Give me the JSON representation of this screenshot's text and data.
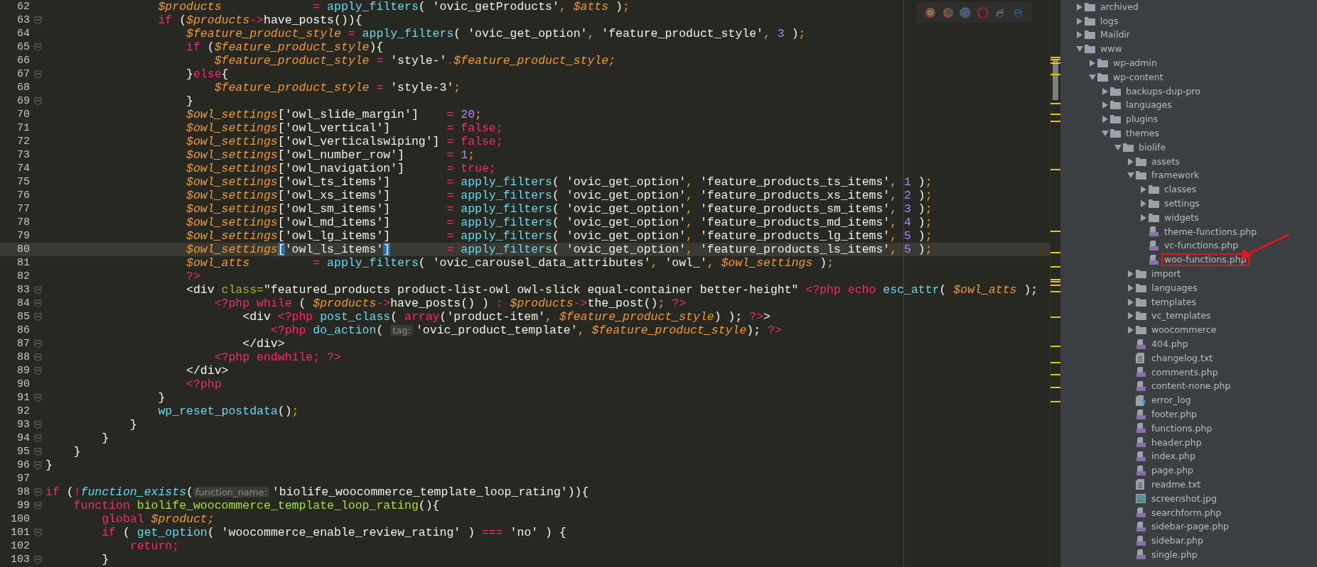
{
  "editor": {
    "lines": [
      {
        "number": "62",
        "fold": false,
        "current": false,
        "tokens": [
          {
            "kind": "var",
            "text": "                $products"
          },
          {
            "kind": "op",
            "text": "             ="
          },
          {
            "kind": "fn",
            "text": " apply_filters"
          },
          {
            "kind": "plain",
            "text": "( "
          },
          {
            "kind": "str",
            "text": "'ovic_getProducts'"
          },
          {
            "kind": "punc",
            "text": ", "
          },
          {
            "kind": "var",
            "text": "$atts"
          },
          {
            "kind": "plain",
            "text": " )"
          },
          {
            "kind": "punc",
            "text": ";"
          }
        ]
      },
      {
        "number": "63",
        "fold": true,
        "current": false,
        "tokens": [
          {
            "kind": "kw",
            "text": "                if"
          },
          {
            "kind": "plain",
            "text": " ("
          },
          {
            "kind": "var",
            "text": "$products"
          },
          {
            "kind": "op",
            "text": "->"
          },
          {
            "kind": "plain",
            "text": "have_posts()){"
          }
        ]
      },
      {
        "number": "64",
        "fold": false,
        "current": false,
        "tokens": [
          {
            "kind": "var",
            "text": "                    $feature_product_style"
          },
          {
            "kind": "op",
            "text": " ="
          },
          {
            "kind": "fn",
            "text": " apply_filters"
          },
          {
            "kind": "plain",
            "text": "( "
          },
          {
            "kind": "str",
            "text": "'ovic_get_option'"
          },
          {
            "kind": "punc",
            "text": ", "
          },
          {
            "kind": "str",
            "text": "'feature_product_style'"
          },
          {
            "kind": "punc",
            "text": ", "
          },
          {
            "kind": "num",
            "text": "3"
          },
          {
            "kind": "plain",
            "text": " )"
          },
          {
            "kind": "punc",
            "text": ";"
          }
        ]
      },
      {
        "number": "65",
        "fold": true,
        "current": false,
        "tokens": [
          {
            "kind": "kw",
            "text": "                    if"
          },
          {
            "kind": "plain",
            "text": " ("
          },
          {
            "kind": "var",
            "text": "$feature_product_style"
          },
          {
            "kind": "plain",
            "text": "){"
          }
        ]
      },
      {
        "number": "66",
        "fold": false,
        "current": false,
        "tokens": [
          {
            "kind": "var",
            "text": "                        $feature_product_style"
          },
          {
            "kind": "op",
            "text": " ="
          },
          {
            "kind": "str",
            "text": " 'style-'"
          },
          {
            "kind": "op",
            "text": "."
          },
          {
            "kind": "var",
            "text": "$feature_product_style;"
          }
        ]
      },
      {
        "number": "67",
        "fold": true,
        "current": false,
        "tokens": [
          {
            "kind": "plain",
            "text": "                    }"
          },
          {
            "kind": "kw",
            "text": "else"
          },
          {
            "kind": "plain",
            "text": "{"
          }
        ]
      },
      {
        "number": "68",
        "fold": false,
        "current": false,
        "tokens": [
          {
            "kind": "var",
            "text": "                        $feature_product_style"
          },
          {
            "kind": "op",
            "text": " ="
          },
          {
            "kind": "str",
            "text": " 'style-3'"
          },
          {
            "kind": "punc",
            "text": ";"
          }
        ]
      },
      {
        "number": "69",
        "fold": true,
        "current": false,
        "tokens": [
          {
            "kind": "plain",
            "text": "                    }"
          }
        ]
      },
      {
        "number": "70",
        "fold": false,
        "current": false,
        "tokens": [
          {
            "kind": "var",
            "text": "                    $owl_settings"
          },
          {
            "kind": "plain",
            "text": "["
          },
          {
            "kind": "str",
            "text": "'owl_slide_margin'"
          },
          {
            "kind": "plain",
            "text": "]    "
          },
          {
            "kind": "op",
            "text": "="
          },
          {
            "kind": "num",
            "text": " 20"
          },
          {
            "kind": "punc",
            "text": ";"
          }
        ]
      },
      {
        "number": "71",
        "fold": false,
        "current": false,
        "tokens": [
          {
            "kind": "var",
            "text": "                    $owl_settings"
          },
          {
            "kind": "plain",
            "text": "["
          },
          {
            "kind": "str",
            "text": "'owl_vertical'"
          },
          {
            "kind": "plain",
            "text": "]        "
          },
          {
            "kind": "op",
            "text": "="
          },
          {
            "kind": "kw",
            "text": " false;"
          }
        ]
      },
      {
        "number": "72",
        "fold": false,
        "current": false,
        "tokens": [
          {
            "kind": "var",
            "text": "                    $owl_settings"
          },
          {
            "kind": "plain",
            "text": "["
          },
          {
            "kind": "str",
            "text": "'owl_verticalswiping'"
          },
          {
            "kind": "plain",
            "text": "] "
          },
          {
            "kind": "op",
            "text": "="
          },
          {
            "kind": "kw",
            "text": " false;"
          }
        ]
      },
      {
        "number": "73",
        "fold": false,
        "current": false,
        "tokens": [
          {
            "kind": "var",
            "text": "                    $owl_settings"
          },
          {
            "kind": "plain",
            "text": "["
          },
          {
            "kind": "str",
            "text": "'owl_number_row'"
          },
          {
            "kind": "plain",
            "text": "]      "
          },
          {
            "kind": "op",
            "text": "="
          },
          {
            "kind": "num",
            "text": " 1"
          },
          {
            "kind": "punc",
            "text": ";"
          }
        ]
      },
      {
        "number": "74",
        "fold": false,
        "current": false,
        "tokens": [
          {
            "kind": "var",
            "text": "                    $owl_settings"
          },
          {
            "kind": "plain",
            "text": "["
          },
          {
            "kind": "str",
            "text": "'owl_navigation'"
          },
          {
            "kind": "plain",
            "text": "]      "
          },
          {
            "kind": "op",
            "text": "="
          },
          {
            "kind": "kw",
            "text": " true;"
          }
        ]
      },
      {
        "number": "75",
        "fold": false,
        "current": false,
        "tokens": [
          {
            "kind": "var",
            "text": "                    $owl_settings"
          },
          {
            "kind": "plain",
            "text": "["
          },
          {
            "kind": "str",
            "text": "'owl_ts_items'"
          },
          {
            "kind": "plain",
            "text": "]        "
          },
          {
            "kind": "op",
            "text": "="
          },
          {
            "kind": "fn",
            "text": " apply_filters"
          },
          {
            "kind": "plain",
            "text": "( "
          },
          {
            "kind": "str",
            "text": "'ovic_get_option'"
          },
          {
            "kind": "punc",
            "text": ", "
          },
          {
            "kind": "str",
            "text": "'feature_products_ts_items'"
          },
          {
            "kind": "punc",
            "text": ", "
          },
          {
            "kind": "num",
            "text": "1"
          },
          {
            "kind": "plain",
            "text": " )"
          },
          {
            "kind": "punc",
            "text": ";"
          }
        ]
      },
      {
        "number": "76",
        "fold": false,
        "current": false,
        "tokens": [
          {
            "kind": "var",
            "text": "                    $owl_settings"
          },
          {
            "kind": "plain",
            "text": "["
          },
          {
            "kind": "str",
            "text": "'owl_xs_items'"
          },
          {
            "kind": "plain",
            "text": "]        "
          },
          {
            "kind": "op",
            "text": "="
          },
          {
            "kind": "fn",
            "text": " apply_filters"
          },
          {
            "kind": "plain",
            "text": "( "
          },
          {
            "kind": "str",
            "text": "'ovic_get_option'"
          },
          {
            "kind": "punc",
            "text": ", "
          },
          {
            "kind": "str",
            "text": "'feature_products_xs_items'"
          },
          {
            "kind": "punc",
            "text": ", "
          },
          {
            "kind": "num",
            "text": "2"
          },
          {
            "kind": "plain",
            "text": " )"
          },
          {
            "kind": "punc",
            "text": ";"
          }
        ]
      },
      {
        "number": "77",
        "fold": false,
        "current": false,
        "tokens": [
          {
            "kind": "var",
            "text": "                    $owl_settings"
          },
          {
            "kind": "plain",
            "text": "["
          },
          {
            "kind": "str",
            "text": "'owl_sm_items'"
          },
          {
            "kind": "plain",
            "text": "]        "
          },
          {
            "kind": "op",
            "text": "="
          },
          {
            "kind": "fn",
            "text": " apply_filters"
          },
          {
            "kind": "plain",
            "text": "( "
          },
          {
            "kind": "str",
            "text": "'ovic_get_option'"
          },
          {
            "kind": "punc",
            "text": ", "
          },
          {
            "kind": "str",
            "text": "'feature_products_sm_items'"
          },
          {
            "kind": "punc",
            "text": ", "
          },
          {
            "kind": "num",
            "text": "3"
          },
          {
            "kind": "plain",
            "text": " )"
          },
          {
            "kind": "punc",
            "text": ";"
          }
        ]
      },
      {
        "number": "78",
        "fold": false,
        "current": false,
        "tokens": [
          {
            "kind": "var",
            "text": "                    $owl_settings"
          },
          {
            "kind": "plain",
            "text": "["
          },
          {
            "kind": "str",
            "text": "'owl_md_items'"
          },
          {
            "kind": "plain",
            "text": "]        "
          },
          {
            "kind": "op",
            "text": "="
          },
          {
            "kind": "fn",
            "text": " apply_filters"
          },
          {
            "kind": "plain",
            "text": "( "
          },
          {
            "kind": "str",
            "text": "'ovic_get_option'"
          },
          {
            "kind": "punc",
            "text": ", "
          },
          {
            "kind": "str",
            "text": "'feature_products_md_items'"
          },
          {
            "kind": "punc",
            "text": ", "
          },
          {
            "kind": "num",
            "text": "4"
          },
          {
            "kind": "plain",
            "text": " )"
          },
          {
            "kind": "punc",
            "text": ";"
          }
        ]
      },
      {
        "number": "79",
        "fold": false,
        "current": false,
        "tokens": [
          {
            "kind": "var",
            "text": "                    $owl_settings"
          },
          {
            "kind": "plain",
            "text": "["
          },
          {
            "kind": "str",
            "text": "'owl_lg_items'"
          },
          {
            "kind": "plain",
            "text": "]        "
          },
          {
            "kind": "op",
            "text": "="
          },
          {
            "kind": "fn",
            "text": " apply_filters"
          },
          {
            "kind": "plain",
            "text": "( "
          },
          {
            "kind": "str",
            "text": "'ovic_get_option'"
          },
          {
            "kind": "punc",
            "text": ", "
          },
          {
            "kind": "str",
            "text": "'feature_products_lg_items'"
          },
          {
            "kind": "punc",
            "text": ", "
          },
          {
            "kind": "num",
            "text": "5"
          },
          {
            "kind": "plain",
            "text": " )"
          },
          {
            "kind": "punc",
            "text": ";"
          }
        ]
      },
      {
        "number": "80",
        "fold": false,
        "current": true,
        "tokens": [
          {
            "kind": "var",
            "text": "                    $owl_settings"
          },
          {
            "kind": "match",
            "text": "["
          },
          {
            "kind": "str",
            "text": "'owl_ls_items'"
          },
          {
            "kind": "match",
            "text": "]"
          },
          {
            "kind": "op",
            "text": "        ="
          },
          {
            "kind": "fn",
            "text": " apply_filters"
          },
          {
            "kind": "plain",
            "text": "( "
          },
          {
            "kind": "str",
            "text": "'ovic_get_option'"
          },
          {
            "kind": "punc",
            "text": ", "
          },
          {
            "kind": "str",
            "text": "'feature_products_ls_items'"
          },
          {
            "kind": "punc",
            "text": ", "
          },
          {
            "kind": "num",
            "text": "5"
          },
          {
            "kind": "plain",
            "text": " )"
          },
          {
            "kind": "punc",
            "text": ";"
          }
        ]
      },
      {
        "number": "81",
        "fold": false,
        "current": false,
        "tokens": [
          {
            "kind": "var",
            "text": "                    $owl_atts"
          },
          {
            "kind": "op",
            "text": "         ="
          },
          {
            "kind": "fn",
            "text": " apply_filters"
          },
          {
            "kind": "plain",
            "text": "( "
          },
          {
            "kind": "str",
            "text": "'ovic_carousel_data_attributes'"
          },
          {
            "kind": "punc",
            "text": ", "
          },
          {
            "kind": "str",
            "text": "'owl_'"
          },
          {
            "kind": "punc",
            "text": ", "
          },
          {
            "kind": "var",
            "text": "$owl_settings"
          },
          {
            "kind": "plain",
            "text": " )"
          },
          {
            "kind": "punc",
            "text": ";"
          }
        ]
      },
      {
        "number": "82",
        "fold": false,
        "current": false,
        "tokens": [
          {
            "kind": "kw",
            "text": "                    ?>"
          }
        ]
      },
      {
        "number": "83",
        "fold": true,
        "current": false,
        "tokens": [
          {
            "kind": "plain",
            "text": "                    <div "
          },
          {
            "kind": "attr",
            "text": "class="
          },
          {
            "kind": "str",
            "text": "\"featured_products product-list-owl owl-slick equal-container better-height\""
          },
          {
            "kind": "kw",
            "text": " <?php echo"
          },
          {
            "kind": "fn",
            "text": " esc_attr"
          },
          {
            "kind": "plain",
            "text": "( "
          },
          {
            "kind": "var",
            "text": "$owl_atts"
          },
          {
            "kind": "plain",
            "text": " );"
          }
        ]
      },
      {
        "number": "84",
        "fold": true,
        "current": false,
        "tokens": [
          {
            "kind": "kw",
            "text": "                        <?php while"
          },
          {
            "kind": "plain",
            "text": " ( "
          },
          {
            "kind": "var",
            "text": "$products"
          },
          {
            "kind": "op",
            "text": "->"
          },
          {
            "kind": "plain",
            "text": "have_posts() ) "
          },
          {
            "kind": "op",
            "text": ":"
          },
          {
            "kind": "var",
            "text": " $products"
          },
          {
            "kind": "op",
            "text": "->"
          },
          {
            "kind": "plain",
            "text": "the_post()"
          },
          {
            "kind": "punc",
            "text": ";"
          },
          {
            "kind": "kw",
            "text": " ?>"
          }
        ]
      },
      {
        "number": "85",
        "fold": true,
        "current": false,
        "tokens": [
          {
            "kind": "plain",
            "text": "                            <div "
          },
          {
            "kind": "kw",
            "text": "<?php"
          },
          {
            "kind": "fn",
            "text": " post_class"
          },
          {
            "kind": "plain",
            "text": "( "
          },
          {
            "kind": "kw",
            "text": "array"
          },
          {
            "kind": "plain",
            "text": "("
          },
          {
            "kind": "str",
            "text": "'product-item'"
          },
          {
            "kind": "punc",
            "text": ", "
          },
          {
            "kind": "var",
            "text": "$feature_product_style"
          },
          {
            "kind": "plain",
            "text": ") ); "
          },
          {
            "kind": "kw",
            "text": "?>"
          },
          {
            "kind": "plain",
            "text": ">"
          }
        ]
      },
      {
        "number": "86",
        "fold": false,
        "current": false,
        "tokens": [
          {
            "kind": "kw",
            "text": "                                <?php"
          },
          {
            "kind": "fn",
            "text": " do_action"
          },
          {
            "kind": "plain",
            "text": "( "
          },
          {
            "kind": "hint",
            "text": "tag:"
          },
          {
            "kind": "str",
            "text": "'ovic_product_template'"
          },
          {
            "kind": "punc",
            "text": ", "
          },
          {
            "kind": "var",
            "text": "$feature_product_style"
          },
          {
            "kind": "plain",
            "text": "); "
          },
          {
            "kind": "kw",
            "text": "?>"
          }
        ]
      },
      {
        "number": "87",
        "fold": true,
        "current": false,
        "tokens": [
          {
            "kind": "plain",
            "text": "                            </div>"
          }
        ]
      },
      {
        "number": "88",
        "fold": true,
        "current": false,
        "tokens": [
          {
            "kind": "kw",
            "text": "                        <?php endwhile; ?>"
          }
        ]
      },
      {
        "number": "89",
        "fold": true,
        "current": false,
        "tokens": [
          {
            "kind": "plain",
            "text": "                    </div>"
          }
        ]
      },
      {
        "number": "90",
        "fold": false,
        "current": false,
        "tokens": [
          {
            "kind": "kw",
            "text": "                    <?php"
          }
        ]
      },
      {
        "number": "91",
        "fold": true,
        "current": false,
        "tokens": [
          {
            "kind": "plain",
            "text": "                }"
          }
        ]
      },
      {
        "number": "92",
        "fold": false,
        "current": false,
        "tokens": [
          {
            "kind": "fn",
            "text": "                wp_reset_postdata"
          },
          {
            "kind": "plain",
            "text": "()"
          },
          {
            "kind": "punc",
            "text": ";"
          }
        ]
      },
      {
        "number": "93",
        "fold": true,
        "current": false,
        "tokens": [
          {
            "kind": "plain",
            "text": "            }"
          }
        ]
      },
      {
        "number": "94",
        "fold": true,
        "current": false,
        "tokens": [
          {
            "kind": "plain",
            "text": "        }"
          }
        ]
      },
      {
        "number": "95",
        "fold": true,
        "current": false,
        "tokens": [
          {
            "kind": "plain",
            "text": "    }"
          }
        ]
      },
      {
        "number": "96",
        "fold": true,
        "current": false,
        "tokens": [
          {
            "kind": "plain",
            "text": "}"
          }
        ]
      },
      {
        "number": "97",
        "fold": false,
        "current": false
      },
      {
        "number": "98",
        "fold": true,
        "current": false,
        "tokens": [
          {
            "kind": "kw",
            "text": "if"
          },
          {
            "kind": "plain",
            "text": " ("
          },
          {
            "kind": "op",
            "text": "!"
          },
          {
            "kind": "builtin",
            "text": "function_exists"
          },
          {
            "kind": "plain",
            "text": "("
          },
          {
            "kind": "hint",
            "text": "function_name:"
          },
          {
            "kind": "str",
            "text": "'biolife_woocommerce_template_loop_rating'"
          },
          {
            "kind": "plain",
            "text": ")){"
          }
        ]
      },
      {
        "number": "99",
        "fold": true,
        "current": false,
        "tokens": [
          {
            "kind": "kw",
            "text": "    function"
          },
          {
            "kind": "def",
            "text": " biolife_woocommerce_template_loop_rating"
          },
          {
            "kind": "plain",
            "text": "(){"
          }
        ]
      },
      {
        "number": "100",
        "fold": false,
        "current": false,
        "tokens": [
          {
            "kind": "kw",
            "text": "        global"
          },
          {
            "kind": "var",
            "text": " $product;"
          }
        ]
      },
      {
        "number": "101",
        "fold": true,
        "current": false,
        "tokens": [
          {
            "kind": "kw",
            "text": "        if"
          },
          {
            "kind": "plain",
            "text": " ( "
          },
          {
            "kind": "fn",
            "text": "get_option"
          },
          {
            "kind": "plain",
            "text": "( "
          },
          {
            "kind": "str",
            "text": "'woocommerce_enable_review_rating'"
          },
          {
            "kind": "plain",
            "text": " ) "
          },
          {
            "kind": "op",
            "text": "==="
          },
          {
            "kind": "str",
            "text": " 'no'"
          },
          {
            "kind": "plain",
            "text": " ) {"
          }
        ]
      },
      {
        "number": "102",
        "fold": false,
        "current": false,
        "tokens": [
          {
            "kind": "kw",
            "text": "            return;"
          }
        ]
      },
      {
        "number": "103",
        "fold": true,
        "current": false,
        "tokens": [
          {
            "kind": "plain",
            "text": "        }"
          }
        ]
      }
    ]
  },
  "project_tree": {
    "items": [
      {
        "name": "archived",
        "kind": "folder",
        "expanded": false
      },
      {
        "name": "logs",
        "kind": "folder",
        "expanded": false
      },
      {
        "name": "Maildir",
        "kind": "folder",
        "expanded": false
      },
      {
        "name": "www",
        "kind": "folder",
        "expanded": true,
        "children": [
          {
            "name": "wp-admin",
            "kind": "folder",
            "expanded": false
          },
          {
            "name": "wp-content",
            "kind": "folder",
            "expanded": true,
            "children": [
              {
                "name": "backups-dup-pro",
                "kind": "folder",
                "expanded": false
              },
              {
                "name": "languages",
                "kind": "folder",
                "expanded": false
              },
              {
                "name": "plugins",
                "kind": "folder",
                "expanded": false
              },
              {
                "name": "themes",
                "kind": "folder",
                "expanded": true,
                "children": [
                  {
                    "name": "biolife",
                    "kind": "folder",
                    "expanded": true,
                    "children": [
                      {
                        "name": "assets",
                        "kind": "folder",
                        "expanded": false
                      },
                      {
                        "name": "framework",
                        "kind": "folder",
                        "expanded": true,
                        "children": [
                          {
                            "name": "classes",
                            "kind": "folder",
                            "expanded": false,
                            "annotated": false
                          },
                          {
                            "name": "settings",
                            "kind": "folder",
                            "expanded": false,
                            "annotated": false
                          },
                          {
                            "name": "widgets",
                            "kind": "folder",
                            "expanded": false,
                            "annotated": false
                          },
                          {
                            "name": "theme-functions.php",
                            "kind": "php",
                            "annotated": false
                          },
                          {
                            "name": "vc-functions.php",
                            "kind": "php",
                            "annotated": false
                          },
                          {
                            "name": "woo-functions.php",
                            "kind": "php",
                            "annotated": true
                          }
                        ]
                      },
                      {
                        "name": "import",
                        "kind": "folder",
                        "expanded": false
                      },
                      {
                        "name": "languages",
                        "kind": "folder",
                        "expanded": false
                      },
                      {
                        "name": "templates",
                        "kind": "folder",
                        "expanded": false
                      },
                      {
                        "name": "vc_templates",
                        "kind": "folder",
                        "expanded": false
                      },
                      {
                        "name": "woocommerce",
                        "kind": "folder",
                        "expanded": false
                      },
                      {
                        "name": "404.php",
                        "kind": "php"
                      },
                      {
                        "name": "changelog.txt",
                        "kind": "text"
                      },
                      {
                        "name": "comments.php",
                        "kind": "php"
                      },
                      {
                        "name": "content-none.php",
                        "kind": "php"
                      },
                      {
                        "name": "error_log",
                        "kind": "unknown"
                      },
                      {
                        "name": "footer.php",
                        "kind": "php"
                      },
                      {
                        "name": "functions.php",
                        "kind": "php"
                      },
                      {
                        "name": "header.php",
                        "kind": "php"
                      },
                      {
                        "name": "index.php",
                        "kind": "php"
                      },
                      {
                        "name": "page.php",
                        "kind": "php"
                      },
                      {
                        "name": "readme.txt",
                        "kind": "text"
                      },
                      {
                        "name": "screenshot.jpg",
                        "kind": "image"
                      },
                      {
                        "name": "searchform.php",
                        "kind": "php"
                      },
                      {
                        "name": "sidebar-page.php",
                        "kind": "php"
                      },
                      {
                        "name": "sidebar.php",
                        "kind": "php"
                      },
                      {
                        "name": "single.php",
                        "kind": "php"
                      }
                    ]
                  }
                ]
              }
            ]
          }
        ]
      }
    ]
  }
}
